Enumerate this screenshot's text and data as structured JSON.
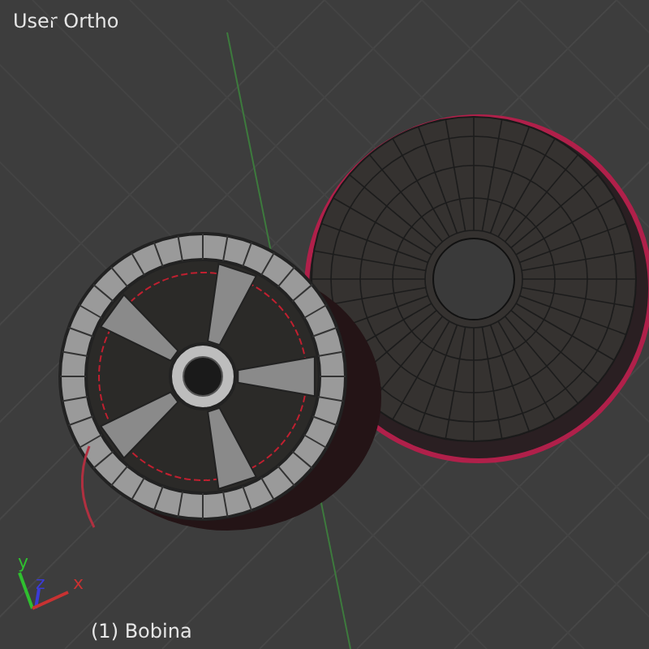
{
  "viewport": {
    "view_name": "User Ortho",
    "object_label": "(1) Bobina",
    "axes": [
      {
        "label": "y",
        "color": "#2fbf2f"
      },
      {
        "label": "z",
        "color": "#3b3bd6"
      },
      {
        "label": "x",
        "color": "#c83232"
      }
    ]
  }
}
